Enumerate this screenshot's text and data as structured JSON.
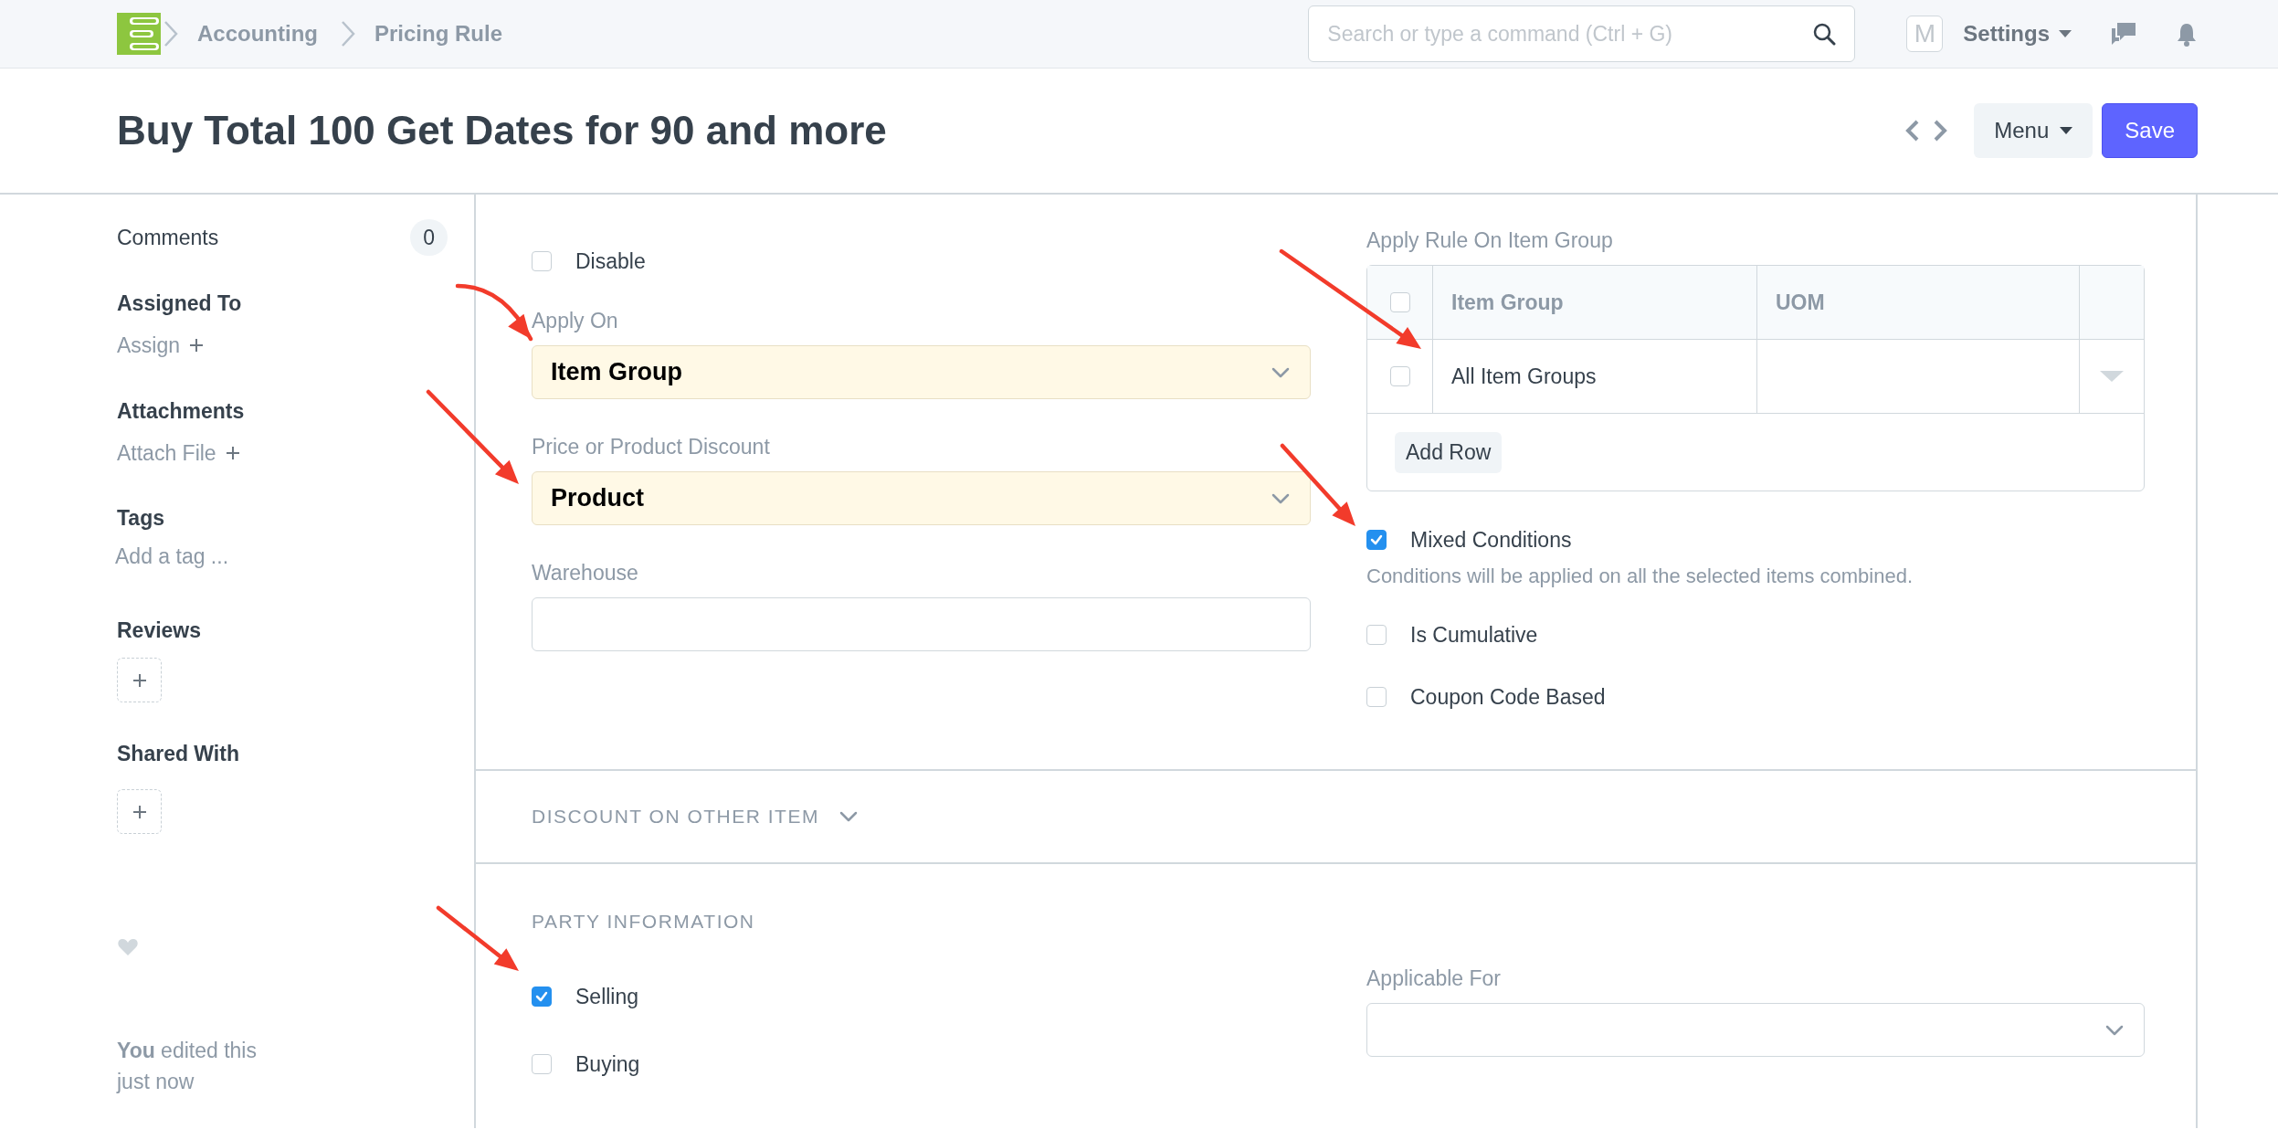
{
  "navbar": {
    "breadcrumbs": [
      "Accounting",
      "Pricing Rule"
    ],
    "search": {
      "placeholder": "Search or type a command (Ctrl + G)"
    },
    "avatar": "M",
    "settings": "Settings"
  },
  "page_header": {
    "title": "Buy Total 100 Get Dates for 90 and more",
    "menu": "Menu",
    "save": "Save"
  },
  "sidebar": {
    "comments": {
      "label": "Comments",
      "count": "0"
    },
    "assigned_to": {
      "heading": "Assigned To",
      "action": "Assign"
    },
    "attachments": {
      "heading": "Attachments",
      "action": "Attach File"
    },
    "tags": {
      "heading": "Tags",
      "placeholder": "Add a tag ..."
    },
    "reviews": {
      "heading": "Reviews"
    },
    "shared_with": {
      "heading": "Shared With"
    },
    "activity": "**You** edited this just now"
  },
  "form": {
    "left_fields": [
      {
        "kind": "checkbox",
        "label": "Disable",
        "checked": false
      },
      {
        "kind": "select",
        "label": "Apply On",
        "value": "Item Group",
        "required": true
      },
      {
        "kind": "select",
        "label": "Price or Product Discount",
        "value": "Product",
        "required": true
      },
      {
        "kind": "input",
        "label": "Warehouse"
      }
    ],
    "table": {
      "label": "Apply Rule On Item Group",
      "all_selected": false,
      "columns": [
        "Item Group",
        "UOM"
      ],
      "rows": [
        {
          "item_group": "All Item Groups",
          "selected": false
        }
      ],
      "add_row": "Add Row"
    },
    "right_fields": [
      {
        "kind": "checkbox",
        "label": "Mixed Conditions",
        "checked": true,
        "description": "Conditions will be applied on all the selected items combined."
      },
      {
        "kind": "checkbox",
        "label": "Is Cumulative",
        "checked": false
      },
      {
        "kind": "checkbox",
        "label": "Coupon Code Based",
        "checked": false
      }
    ]
  },
  "sections": [
    {
      "heading": "DISCOUNT ON OTHER ITEM",
      "collapsed": true
    },
    {
      "heading": "PARTY INFORMATION",
      "left_fields": [
        {
          "kind": "checkbox",
          "label": "Selling",
          "checked": true
        },
        {
          "kind": "checkbox",
          "label": "Buying",
          "checked": false
        }
      ],
      "right_fields": [
        {
          "kind": "select",
          "label": "Applicable For",
          "required": false
        }
      ]
    }
  ]
}
